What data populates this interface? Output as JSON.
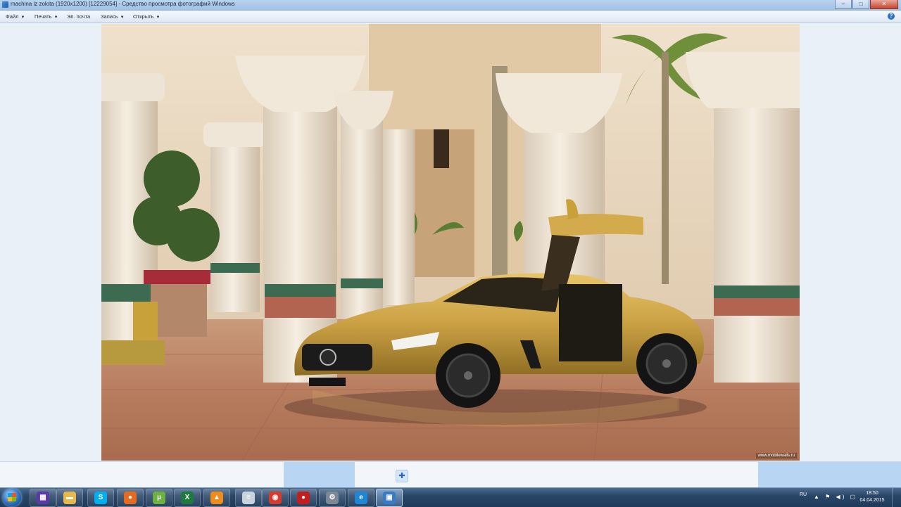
{
  "window": {
    "title": "machina iz zolota (1920x1200) [12229054] - Средство просмотра фотографий Windows",
    "minimize_icon": "minimize-icon",
    "maximize_icon": "maximize-icon",
    "close_icon": "close-icon"
  },
  "menu": {
    "items": [
      {
        "label": "Файл",
        "has_dropdown": true
      },
      {
        "label": "Печать",
        "has_dropdown": true
      },
      {
        "label": "Эл. почта",
        "has_dropdown": false
      },
      {
        "label": "Запись",
        "has_dropdown": true
      },
      {
        "label": "Открыть",
        "has_dropdown": true
      }
    ],
    "help_icon": "help-icon"
  },
  "photo": {
    "subject": "gold-sports-car-gullwing-door-palace-arcade",
    "watermark": "www.mobilewalls.ru"
  },
  "controls": {
    "zoom_icon": "zoom-icon"
  },
  "taskbar": {
    "start_icon": "windows-start-icon",
    "apps": [
      {
        "name": "media-player-icon",
        "glyph": "▦",
        "color": "#5b3aa8"
      },
      {
        "name": "folder-icon",
        "glyph": "▬",
        "color": "#e8b84a"
      },
      {
        "name": "skype-icon",
        "glyph": "S",
        "color": "#00aff0"
      },
      {
        "name": "firefox-icon",
        "glyph": "●",
        "color": "#e66b1e"
      },
      {
        "name": "utorrent-icon",
        "glyph": "µ",
        "color": "#6cb33e"
      },
      {
        "name": "excel-icon",
        "glyph": "X",
        "color": "#1f7a3e"
      },
      {
        "name": "avast-icon",
        "glyph": "▲",
        "color": "#f08c1a"
      },
      {
        "name": "notepad-icon",
        "glyph": "≡",
        "color": "#c9d3de"
      },
      {
        "name": "chrome-icon",
        "glyph": "◉",
        "color": "#d93a2b"
      },
      {
        "name": "record-icon",
        "glyph": "●",
        "color": "#c41d1d"
      },
      {
        "name": "settings-icon",
        "glyph": "⚙",
        "color": "#7d8894"
      },
      {
        "name": "ie-icon",
        "glyph": "e",
        "color": "#1d86d6"
      },
      {
        "name": "photo-viewer-icon",
        "glyph": "▣",
        "color": "#3a7bc8"
      }
    ],
    "tray": {
      "language": "RU",
      "icons": "▲ ⚑ ◀) ▢",
      "time": "18:50",
      "date": "04.04.2015"
    }
  }
}
